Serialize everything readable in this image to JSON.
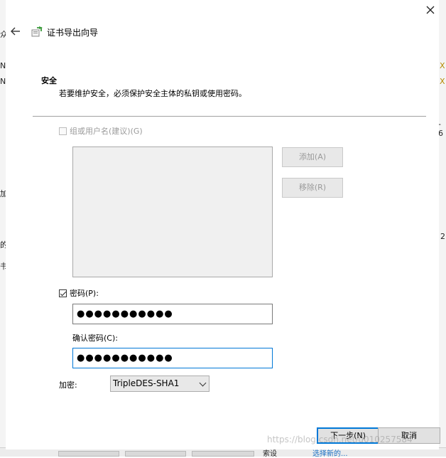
{
  "window": {
    "title": "证书导出向导"
  },
  "section": {
    "title": "安全",
    "description": "若要维护安全，必须保护安全主体的私钥或使用密码。"
  },
  "group_user": {
    "checkbox_label": "组或用户名(建议)(G)",
    "checked": false,
    "enabled": false
  },
  "side_buttons": {
    "add_label": "添加(A)",
    "remove_label": "移除(R)"
  },
  "password": {
    "checkbox_label": "密码(P):",
    "checked": true,
    "value": "●●●●●●●●●●●",
    "confirm_label": "确认密码(C):",
    "confirm_value": "●●●●●●●●●●●"
  },
  "encryption": {
    "label": "加密:",
    "selected": "TripleDES-SHA1"
  },
  "footer": {
    "next_label": "下一步(N)",
    "cancel_label": "取消"
  },
  "watermark": "https://blog.csdn.net/u010257584",
  "background_fragments": {
    "f1": "众",
    "f2": "N",
    "f3": "N",
    "f4": "加",
    "f5": "的",
    "f6": "书",
    "f7": "X",
    "f8": "X",
    "f9": "- 6",
    "f10": "2",
    "f11": "索设",
    "f12": "选择新的..."
  },
  "colors": {
    "accent": "#0078d7",
    "disabled_text": "#9a9a9a"
  }
}
